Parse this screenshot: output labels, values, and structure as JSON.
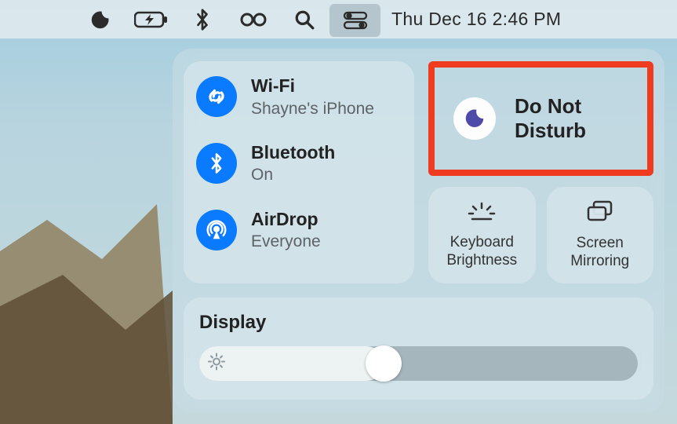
{
  "menubar": {
    "datetime": "Thu Dec 16  2:46 PM"
  },
  "connectivity": {
    "wifi": {
      "title": "Wi-Fi",
      "sub": "Shayne's iPhone"
    },
    "bluetooth": {
      "title": "Bluetooth",
      "sub": "On"
    },
    "airdrop": {
      "title": "AirDrop",
      "sub": "Everyone"
    }
  },
  "dnd": {
    "line1": "Do Not",
    "line2": "Disturb"
  },
  "small": {
    "keyboard": "Keyboard Brightness",
    "mirroring": "Screen Mirroring"
  },
  "display": {
    "title": "Display",
    "brightness_pct": 42
  }
}
